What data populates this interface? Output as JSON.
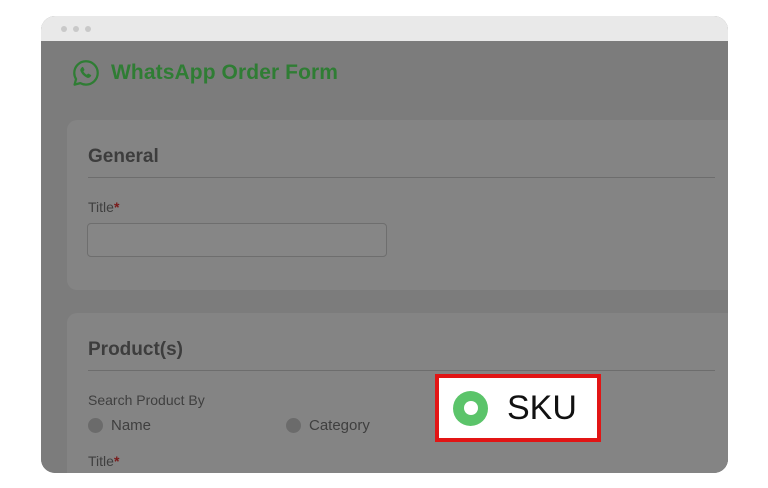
{
  "window": {
    "title_bar_icons": [
      "window-dot-icon",
      "window-dot-icon",
      "window-dot-icon"
    ]
  },
  "header": {
    "title": "WhatsApp Order Form",
    "icon": "whatsapp-icon",
    "brand_color": "#2f7d34"
  },
  "general": {
    "heading": "General",
    "title_label": "Title",
    "required_mark": "*",
    "title_value": ""
  },
  "products": {
    "heading": "Product(s)",
    "search_by_label": "Search Product By",
    "options": [
      {
        "label": "Name",
        "selected": false
      },
      {
        "label": "Category",
        "selected": false
      },
      {
        "label": "SKU",
        "selected": true
      }
    ],
    "title_label": "Title",
    "required_mark": "*",
    "title_value": ""
  },
  "highlight": {
    "border_color": "#e21515",
    "radio_color": "#5bc46a"
  }
}
